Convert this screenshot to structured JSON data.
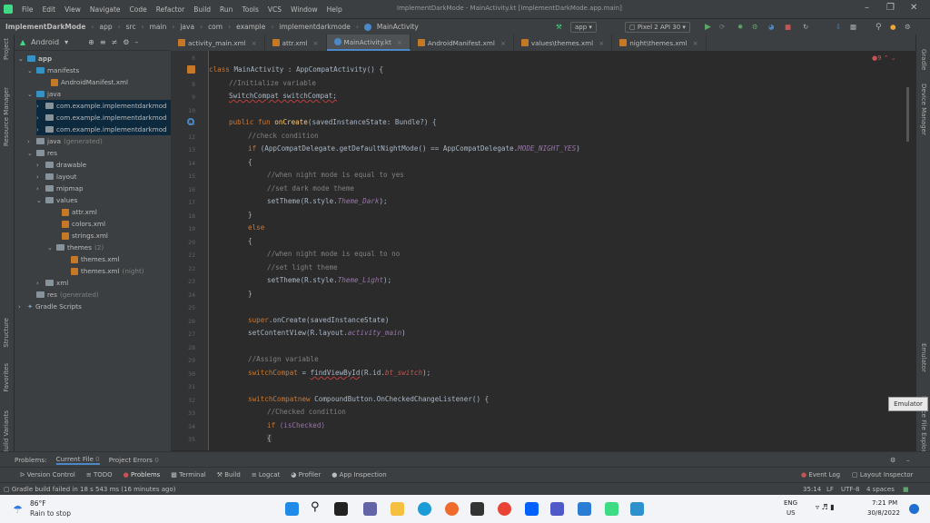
{
  "menu": [
    "File",
    "Edit",
    "View",
    "Navigate",
    "Code",
    "Refactor",
    "Build",
    "Run",
    "Tools",
    "VCS",
    "Window",
    "Help"
  ],
  "window_title": "ImplementDarkMode - MainActivity.kt [ImplementDarkMode.app.main]",
  "breadcrumbs": [
    "ImplementDarkMode",
    "app",
    "src",
    "main",
    "java",
    "com",
    "example",
    "implementdarkmode",
    "MainActivity"
  ],
  "run_config": "app",
  "device": "Pixel 2 API 30",
  "project_view": "Android",
  "tree": {
    "app": "app",
    "manifests": "manifests",
    "manifest_file": "AndroidManifest.xml",
    "java": "java",
    "pkg1": "com.example.implementdarkmod",
    "pkg2": "com.example.implementdarkmod",
    "pkg3": "com.example.implementdarkmod",
    "java_gen": "java",
    "java_gen_note": "(generated)",
    "res": "res",
    "drawable": "drawable",
    "layout": "layout",
    "mipmap": "mipmap",
    "values": "values",
    "attr": "attr.xml",
    "colors": "colors.xml",
    "strings": "strings.xml",
    "themes": "themes",
    "themes_count": "(2)",
    "themes_xml": "themes.xml",
    "themes_night": "themes.xml",
    "themes_night_note": "(night)",
    "xml": "xml",
    "res_gen": "res",
    "res_gen_note": "(generated)",
    "gradle": "Gradle Scripts"
  },
  "tabs": [
    {
      "label": "activity_main.xml"
    },
    {
      "label": "attr.xml"
    },
    {
      "label": "MainActivity.kt"
    },
    {
      "label": "AndroidManifest.xml"
    },
    {
      "label": "values\\themes.xml"
    },
    {
      "label": "night\\themes.xml"
    }
  ],
  "line_numbers": [
    "6",
    "7",
    "8",
    "9",
    "10",
    "11",
    "12",
    "13",
    "14",
    "15",
    "16",
    "17",
    "18",
    "19",
    "20",
    "21",
    "22",
    "23",
    "24",
    "25",
    "26",
    "27",
    "28",
    "29",
    "30",
    "31",
    "32",
    "33",
    "34",
    "35"
  ],
  "code": {
    "l7a": "class ",
    "l7b": "MainActivity : AppCompatActivity() {",
    "l8": "//Initialize variable",
    "l9": "SwitchCompat switchCompat;",
    "l11a": "public fun ",
    "l11b": "onCreate",
    "l11c": "(savedInstanceState: Bundle?) {",
    "l12": "//check condition",
    "l13a": "if ",
    "l13b": "(AppCompatDelegate.getDefaultNightMode() == AppCompatDelegate.",
    "l13c": "MODE_NIGHT_YES",
    ")": ")",
    "l14": "{",
    "l15": "//when night mode is equal to yes",
    "l16": "//set dark mode theme",
    "l17a": "setTheme(R.style.",
    "l17b": "Theme_Dark",
    "l17c": ");",
    "l18": "}",
    "l19": "else",
    "l20": "{",
    "l21": "//when night mode is equal to no",
    "l22": "//set light theme",
    "l23a": "setTheme(R.style.",
    "l23b": "Theme_Light",
    "l23c": ");",
    "l24": "}",
    "l26a": "super",
    "l26b": ".onCreate(savedInstanceState)",
    "l27a": "setContentView(R.layout.",
    "l27b": "activity_main",
    "l27c": ")",
    "l29": "//Assign variable",
    "l30a": "switchCompat",
    " eq": " = ",
    "l30b": "findViewById",
    "l30c": "(R.id.",
    "l30d": "bt_switch",
    "l30e": ");",
    "l32a": "switchCompat",
    ".set": ".setOnCheckedChangeListener(",
    "l32b": "new ",
    "l32c": "CompoundButton.OnCheckedChangeListener() {",
    "l33": "//Checked condition",
    "l34a": "if ",
    "l34b": "(isChecked)",
    "l35": "{"
  },
  "warn_count": "9",
  "left_strip": [
    "Project",
    "Resource Manager",
    "Structure",
    "Favorites",
    "Build Variants"
  ],
  "right_strip": [
    "Gradle",
    "Device Manager",
    "Emulator",
    "Device File Explorer"
  ],
  "tooltip": "Emulator",
  "problems_tabs": [
    "Problems:",
    "Current File",
    "Project Errors"
  ],
  "problems_counts": [
    "0",
    "0"
  ],
  "tool_buttons": [
    "Version Control",
    "TODO",
    "Problems",
    "Terminal",
    "Build",
    "Logcat",
    "Profiler",
    "App Inspection"
  ],
  "tool_right": [
    "Event Log",
    "Layout Inspector"
  ],
  "status_msg": "Gradle build failed in 18 s 543 ms (16 minutes ago)",
  "status_right": [
    "35:14",
    "LF",
    "UTF-8",
    "4 spaces"
  ],
  "weather": {
    "temp": "86°F",
    "desc": "Rain to stop"
  },
  "tray": {
    "lang1": "ENG",
    "lang2": "US",
    "time": "7:21 PM",
    "date": "30/8/2022"
  },
  "colors": {
    "accent": "#4a88c7",
    "editor_bg": "#2b2b2b",
    "panel_bg": "#3c3f41",
    "keyword": "#cc7832"
  }
}
